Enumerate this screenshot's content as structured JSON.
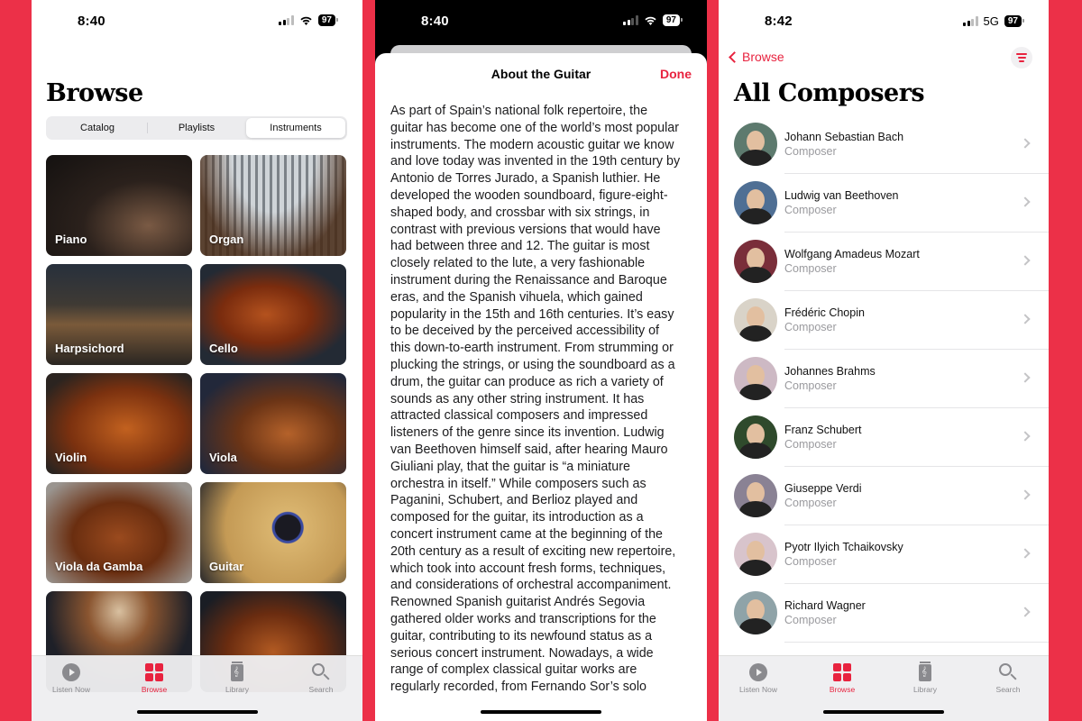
{
  "colors": {
    "background": "#ec3048",
    "accent": "#e8233f"
  },
  "screens": [
    {
      "status": {
        "time": "8:40",
        "battery": "97",
        "network": "wifi"
      },
      "title": "Browse",
      "segments": [
        {
          "label": "Catalog",
          "active": false
        },
        {
          "label": "Playlists",
          "active": false
        },
        {
          "label": "Instruments",
          "active": true
        }
      ],
      "instruments": [
        {
          "label": "Piano"
        },
        {
          "label": "Organ"
        },
        {
          "label": "Harpsichord"
        },
        {
          "label": "Cello"
        },
        {
          "label": "Violin"
        },
        {
          "label": "Viola"
        },
        {
          "label": "Viola da Gamba"
        },
        {
          "label": "Guitar"
        },
        {
          "label": ""
        },
        {
          "label": ""
        }
      ]
    },
    {
      "status": {
        "time": "8:40",
        "battery": "97",
        "network": "wifi"
      },
      "sheet_title": "About the Guitar",
      "done_label": "Done",
      "body_lines": [
        "As part of Spain’s national folk repertoire, the",
        "guitar has become one of the world’s most popular",
        "instruments. The modern acoustic guitar we know",
        "and love today was invented in the 19th century by",
        "Antonio de Torres Jurado, a Spanish luthier. He",
        "developed the wooden soundboard, figure-eight-",
        "shaped body, and crossbar with six strings, in",
        "contrast with previous versions that would have",
        "had between three and 12. The guitar is most",
        "closely related to the lute, a very fashionable",
        "instrument during the Renaissance and Baroque",
        "eras, and the Spanish vihuela, which gained",
        "popularity in the 15th and 16th centuries. It’s easy",
        "to be deceived by the perceived accessibility of",
        "this down-to-earth instrument. From strumming or",
        "plucking the strings, or using the soundboard as a",
        "drum, the guitar can produce as rich a variety of",
        "sounds as any other string instrument. It has",
        "attracted classical composers and impressed",
        "listeners of the genre since its invention. Ludwig",
        "van Beethoven himself said, after hearing Mauro",
        "Giuliani play, that the guitar is “a miniature",
        "orchestra in itself.” While composers such as",
        "Paganini, Schubert, and Berlioz played and",
        "composed for the guitar, its introduction as a",
        "concert instrument came at the beginning of the",
        "20th century as a result of exciting new repertoire,",
        "which took into account fresh forms, techniques,",
        "and considerations of orchestral accompaniment.",
        "Renowned Spanish guitarist Andrés Segovia",
        "gathered older works and transcriptions for the",
        "guitar, contributing to its newfound status as a",
        "serious concert instrument. Nowadays, a wide",
        "range of complex classical guitar works are",
        "regularly recorded, from Fernando Sor’s solo"
      ]
    },
    {
      "status": {
        "time": "8:42",
        "battery": "97",
        "network": "5G"
      },
      "back_label": "Browse",
      "title": "All Composers",
      "composers": [
        {
          "name": "Johann Sebastian Bach",
          "role": "Composer",
          "tint": "#5d7a6e"
        },
        {
          "name": "Ludwig van Beethoven",
          "role": "Composer",
          "tint": "#4f6f94"
        },
        {
          "name": "Wolfgang Amadeus Mozart",
          "role": "Composer",
          "tint": "#7a2e3a"
        },
        {
          "name": "Frédéric Chopin",
          "role": "Composer",
          "tint": "#d9d3c8"
        },
        {
          "name": "Johannes Brahms",
          "role": "Composer",
          "tint": "#cdb9c4"
        },
        {
          "name": "Franz Schubert",
          "role": "Composer",
          "tint": "#2f4a2c"
        },
        {
          "name": "Giuseppe Verdi",
          "role": "Composer",
          "tint": "#8a8294"
        },
        {
          "name": "Pyotr Ilyich Tchaikovsky",
          "role": "Composer",
          "tint": "#d8c4cc"
        },
        {
          "name": "Richard Wagner",
          "role": "Composer",
          "tint": "#8fa3a8"
        }
      ]
    }
  ],
  "tabbar": [
    {
      "label": "Listen Now",
      "icon": "play-circle-icon",
      "active": false
    },
    {
      "label": "Browse",
      "icon": "grid-icon",
      "active": true
    },
    {
      "label": "Library",
      "icon": "library-icon",
      "active": false
    },
    {
      "label": "Search",
      "icon": "search-icon",
      "active": false
    }
  ]
}
